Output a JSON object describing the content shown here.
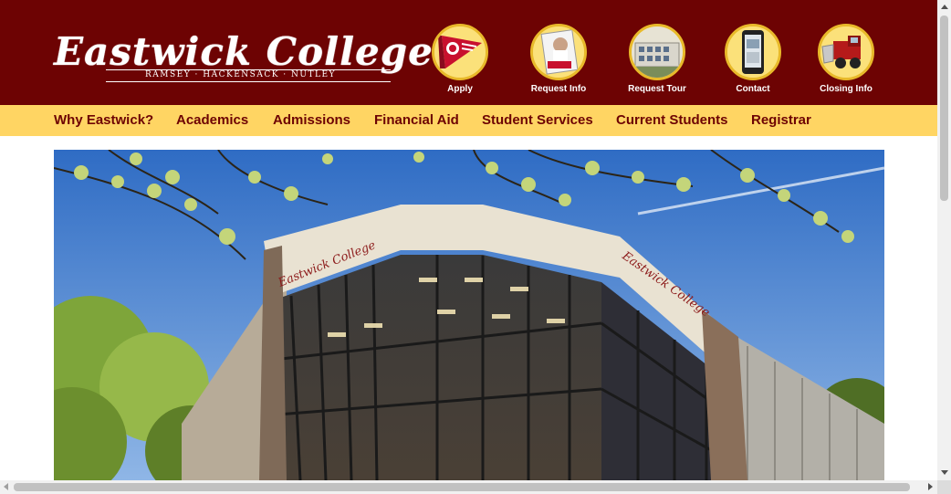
{
  "site": {
    "logo_title": "Eastwick College",
    "logo_subtitle": "RAMSEY · HACKENSACK · NUTLEY"
  },
  "quick_links": [
    {
      "label": "Apply",
      "icon": "pennant-icon"
    },
    {
      "label": "Request Info",
      "icon": "brochure-icon"
    },
    {
      "label": "Request Tour",
      "icon": "building-icon"
    },
    {
      "label": "Contact",
      "icon": "phone-icon"
    },
    {
      "label": "Closing Info",
      "icon": "snowplow-icon"
    }
  ],
  "nav": {
    "items": [
      "Why Eastwick?",
      "Academics",
      "Admissions",
      "Financial Aid",
      "Student Services",
      "Current Students",
      "Registrar"
    ]
  },
  "hero": {
    "building_sign": "Eastwick College"
  },
  "colors": {
    "header_bg": "#6d0303",
    "nav_bg": "#ffd563",
    "nav_text": "#6d0303",
    "icon_gold": "#fbe17a"
  }
}
